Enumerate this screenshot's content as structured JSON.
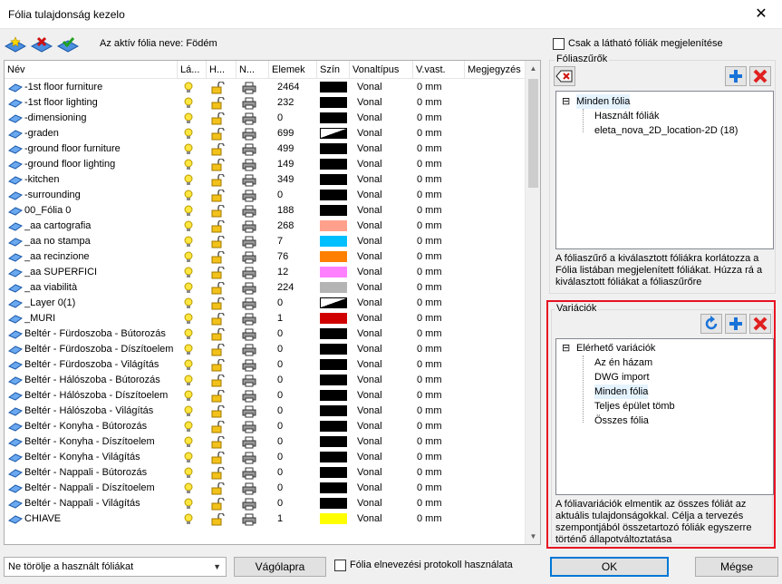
{
  "window": {
    "title": "Fólia tulajdonság kezelo",
    "close_glyph": "✕"
  },
  "toolbar": {
    "buttons": [
      {
        "name": "new-layer-button",
        "icon": "layer-add-icon"
      },
      {
        "name": "delete-layer-button",
        "icon": "layer-delete-icon"
      },
      {
        "name": "set-active-layer-button",
        "icon": "layer-check-icon"
      }
    ],
    "active_label": "Az aktív fólia neve: Födém"
  },
  "grid": {
    "columns": [
      "Név",
      "Lá...",
      "H...",
      "N...",
      "Elemek",
      "Szín",
      "Vonaltípus",
      "V.vast.",
      "Megjegyzés"
    ],
    "rows": [
      {
        "name": "-1st floor furniture",
        "count": "2464",
        "color": "#000000",
        "line": "Vonal",
        "width": "0 mm"
      },
      {
        "name": "-1st floor lighting",
        "count": "232",
        "color": "#000000",
        "line": "Vonal",
        "width": "0 mm"
      },
      {
        "name": "-dimensioning",
        "count": "0",
        "color": "#000000",
        "line": "Vonal",
        "width": "0 mm"
      },
      {
        "name": "-graden",
        "count": "699",
        "color": "bw",
        "line": "Vonal",
        "width": "0 mm"
      },
      {
        "name": "-ground floor furniture",
        "count": "499",
        "color": "#000000",
        "line": "Vonal",
        "width": "0 mm"
      },
      {
        "name": "-ground floor lighting",
        "count": "149",
        "color": "#000000",
        "line": "Vonal",
        "width": "0 mm"
      },
      {
        "name": "-kitchen",
        "count": "349",
        "color": "#000000",
        "line": "Vonal",
        "width": "0 mm"
      },
      {
        "name": "-surrounding",
        "count": "0",
        "color": "#000000",
        "line": "Vonal",
        "width": "0 mm"
      },
      {
        "name": "00_Fólia 0",
        "count": "188",
        "color": "#000000",
        "line": "Vonal",
        "width": "0 mm"
      },
      {
        "name": "_aa cartografia",
        "count": "268",
        "color": "#ffa08c",
        "line": "Vonal",
        "width": "0 mm"
      },
      {
        "name": "_aa no stampa",
        "count": "7",
        "color": "#00bfff",
        "line": "Vonal",
        "width": "0 mm"
      },
      {
        "name": "_aa recinzione",
        "count": "76",
        "color": "#ff8000",
        "line": "Vonal",
        "width": "0 mm"
      },
      {
        "name": "_aa SUPERFICI",
        "count": "12",
        "color": "#ff80ff",
        "line": "Vonal",
        "width": "0 mm"
      },
      {
        "name": "_aa viabilità",
        "count": "224",
        "color": "#b4b4b4",
        "line": "Vonal",
        "width": "0 mm"
      },
      {
        "name": "_Layer 0(1)",
        "count": "0",
        "color": "bw",
        "line": "Vonal",
        "width": "0 mm"
      },
      {
        "name": "_MURI",
        "count": "1",
        "color": "#d00000",
        "line": "Vonal",
        "width": "0 mm"
      },
      {
        "name": "Beltér - Fürdoszoba - Bútorozás",
        "count": "0",
        "color": "#000000",
        "line": "Vonal",
        "width": "0 mm"
      },
      {
        "name": "Beltér - Fürdoszoba - Díszítoelem",
        "count": "0",
        "color": "#000000",
        "line": "Vonal",
        "width": "0 mm"
      },
      {
        "name": "Beltér - Fürdoszoba - Világítás",
        "count": "0",
        "color": "#000000",
        "line": "Vonal",
        "width": "0 mm"
      },
      {
        "name": "Beltér - Hálószoba - Bútorozás",
        "count": "0",
        "color": "#000000",
        "line": "Vonal",
        "width": "0 mm"
      },
      {
        "name": "Beltér - Hálószoba - Díszítoelem",
        "count": "0",
        "color": "#000000",
        "line": "Vonal",
        "width": "0 mm"
      },
      {
        "name": "Beltér - Hálószoba - Világítás",
        "count": "0",
        "color": "#000000",
        "line": "Vonal",
        "width": "0 mm"
      },
      {
        "name": "Beltér - Konyha - Bútorozás",
        "count": "0",
        "color": "#000000",
        "line": "Vonal",
        "width": "0 mm"
      },
      {
        "name": "Beltér - Konyha - Díszítoelem",
        "count": "0",
        "color": "#000000",
        "line": "Vonal",
        "width": "0 mm"
      },
      {
        "name": "Beltér - Konyha - Világítás",
        "count": "0",
        "color": "#000000",
        "line": "Vonal",
        "width": "0 mm"
      },
      {
        "name": "Beltér - Nappali - Bútorozás",
        "count": "0",
        "color": "#000000",
        "line": "Vonal",
        "width": "0 mm"
      },
      {
        "name": "Beltér - Nappali - Díszítoelem",
        "count": "0",
        "color": "#000000",
        "line": "Vonal",
        "width": "0 mm"
      },
      {
        "name": "Beltér - Nappali - Világítás",
        "count": "0",
        "color": "#000000",
        "line": "Vonal",
        "width": "0 mm"
      },
      {
        "name": "CHIAVE",
        "count": "1",
        "color": "#ffff00",
        "line": "Vonal",
        "width": "0 mm"
      }
    ]
  },
  "filters": {
    "visible_only_label": "Csak a látható fóliák megjelenítése",
    "title": "Fóliaszűrők",
    "tree": {
      "root": "Minden fólia",
      "children": [
        "Használt fóliák",
        "eleta_nova_2D_location-2D (18)"
      ]
    },
    "description": "A fóliaszűrő a kiválasztott fóliákra korlátozza a Fólia listában megjelenített fóliákat. Húzza rá a kiválasztott fóliákat a fóliaszűrőre"
  },
  "variations": {
    "title": "Variációk",
    "tree": {
      "root": "Elérhető variációk",
      "children": [
        "Az én házam",
        "DWG import",
        "Minden fólia",
        "Teljes épület tömb",
        "Összes fólia"
      ]
    },
    "description": "A fóliavariációk elmentik az összes fóliát az aktuális tulajdonságokkal. Célja a tervezés szempontjából összetartozó fóliák egyszerre történő állapotváltoztatása"
  },
  "footer": {
    "delete_option": "Ne törölje a használt fóliákat",
    "clipboard_label": "Vágólapra",
    "protocol_label": "Fólia elnevezési protokoll használata",
    "ok_label": "OK",
    "cancel_label": "Mégse"
  },
  "colors": {
    "accent": "#0078d7",
    "highlight_border": "#e81123",
    "add_blue": "#1a73d9",
    "delete_red": "#e02020"
  }
}
